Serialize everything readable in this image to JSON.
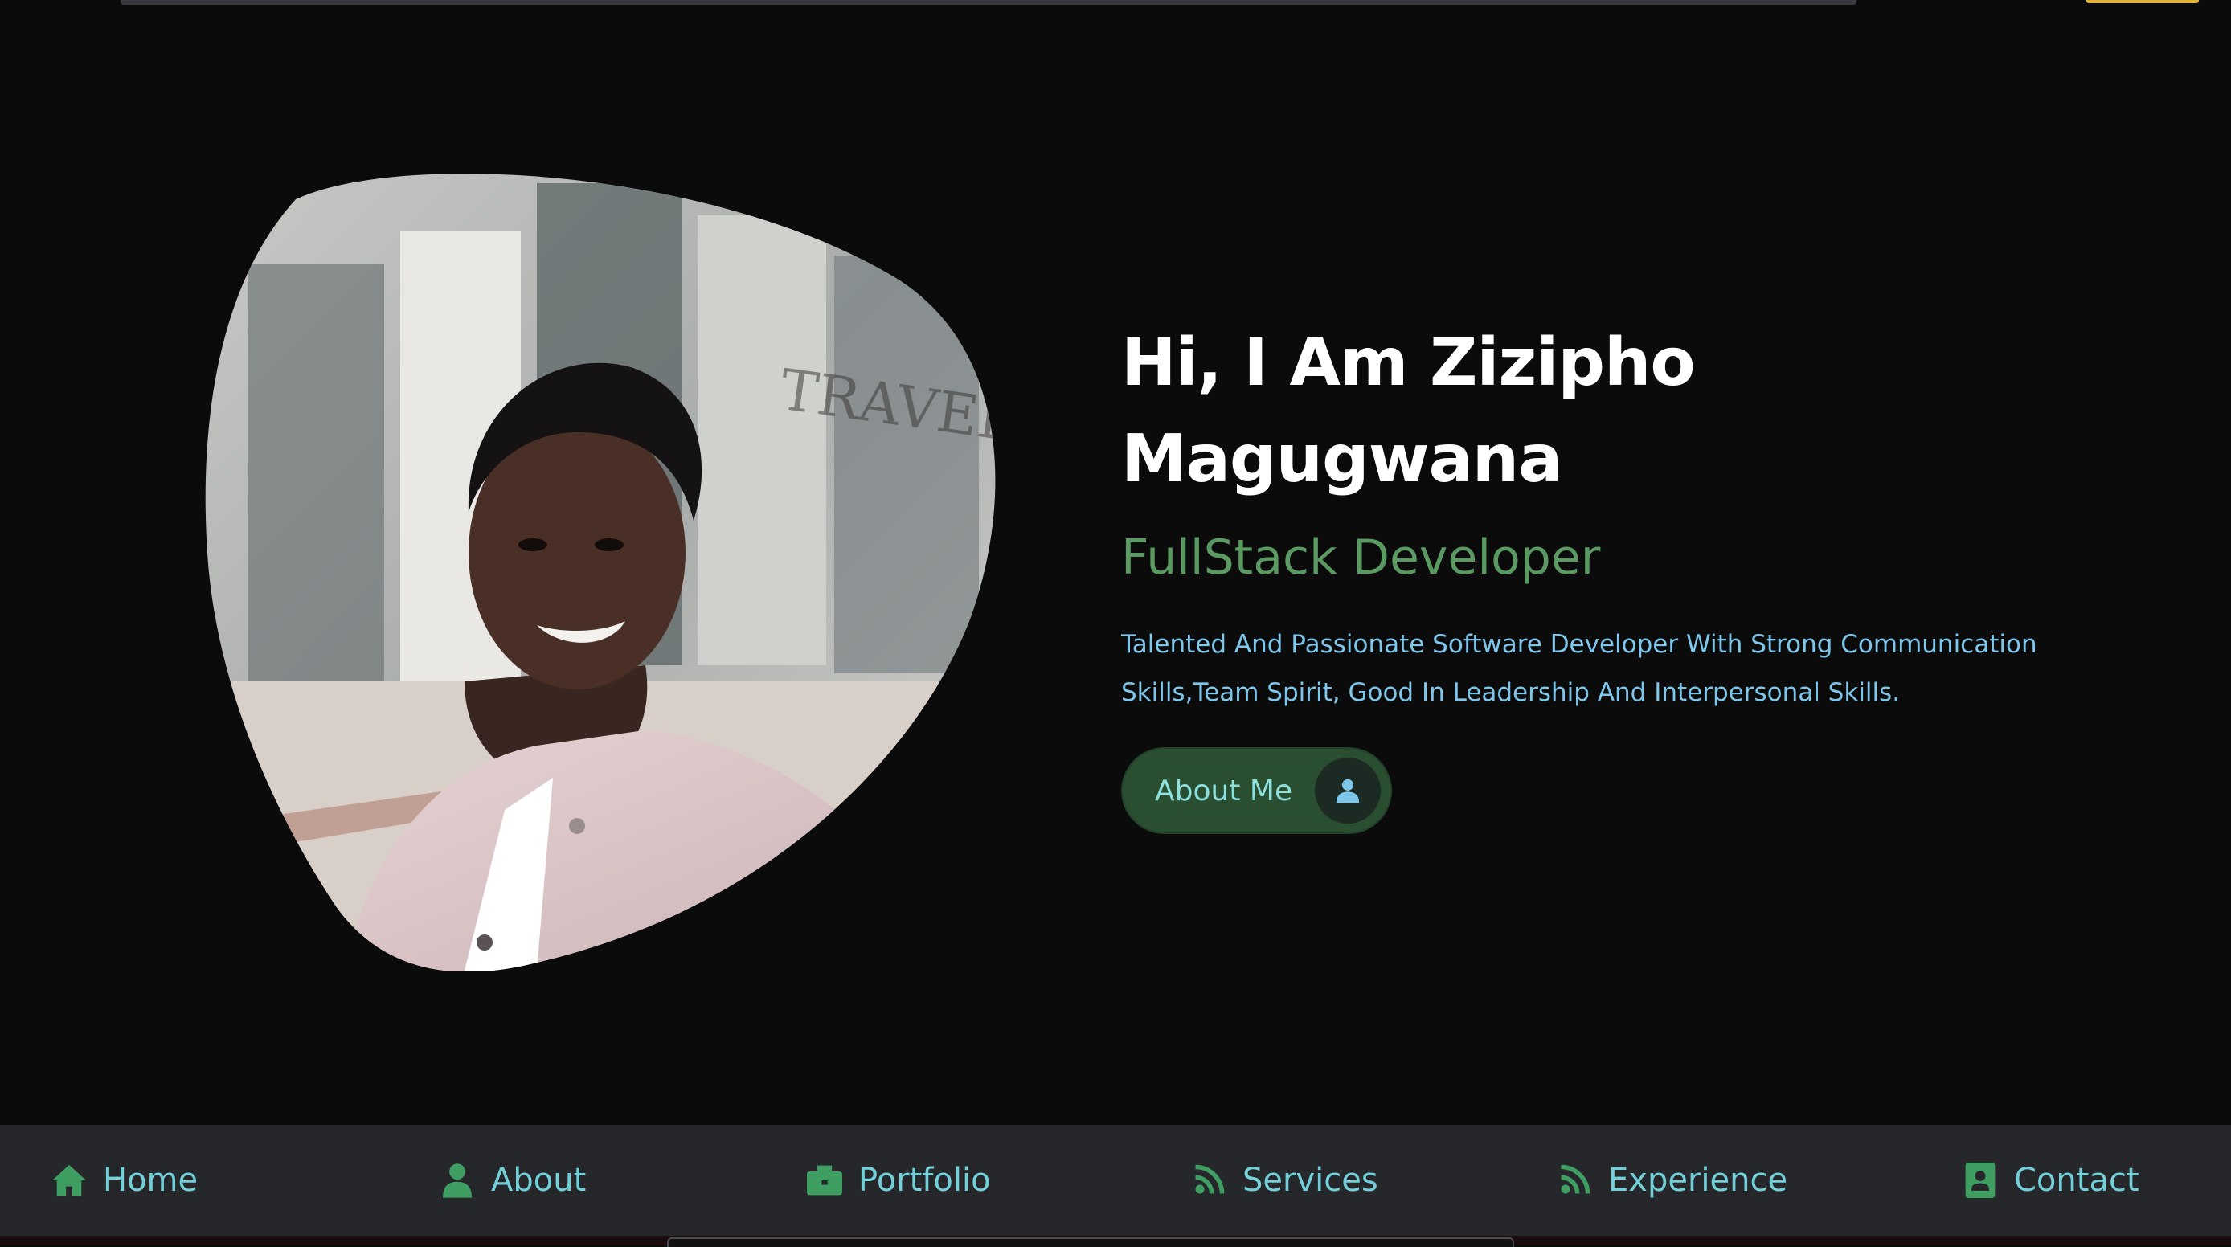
{
  "hero": {
    "headline_line1": "Hi, I Am Zizipho",
    "headline_line2": "Magugwana",
    "role": "FullStack Developer",
    "description": "Talented And Passionate Software Developer With Strong Communication Skills,Team Spirit, Good In Leadership And Interpersonal Skills.",
    "about_button": {
      "label": "About Me",
      "icon": "user-icon"
    },
    "photo_alt": "profile-photo"
  },
  "nav": {
    "items": [
      {
        "label": "Home",
        "icon": "home-icon"
      },
      {
        "label": "About",
        "icon": "user-icon"
      },
      {
        "label": "Portfolio",
        "icon": "briefcase-icon"
      },
      {
        "label": "Services",
        "icon": "broadcast-icon"
      },
      {
        "label": "Experience",
        "icon": "broadcast-icon"
      },
      {
        "label": "Contact",
        "icon": "contact-card-icon"
      }
    ]
  },
  "colors": {
    "background": "#0b0b0c",
    "headline": "#ffffff",
    "role": "#5a9a62",
    "description": "#7ec6ea",
    "button_bg": "#2a4e30",
    "button_text": "#8de0de",
    "nav_bg": "#25272b",
    "nav_text": "#74d0d8",
    "nav_icon": "#3f9e62"
  }
}
